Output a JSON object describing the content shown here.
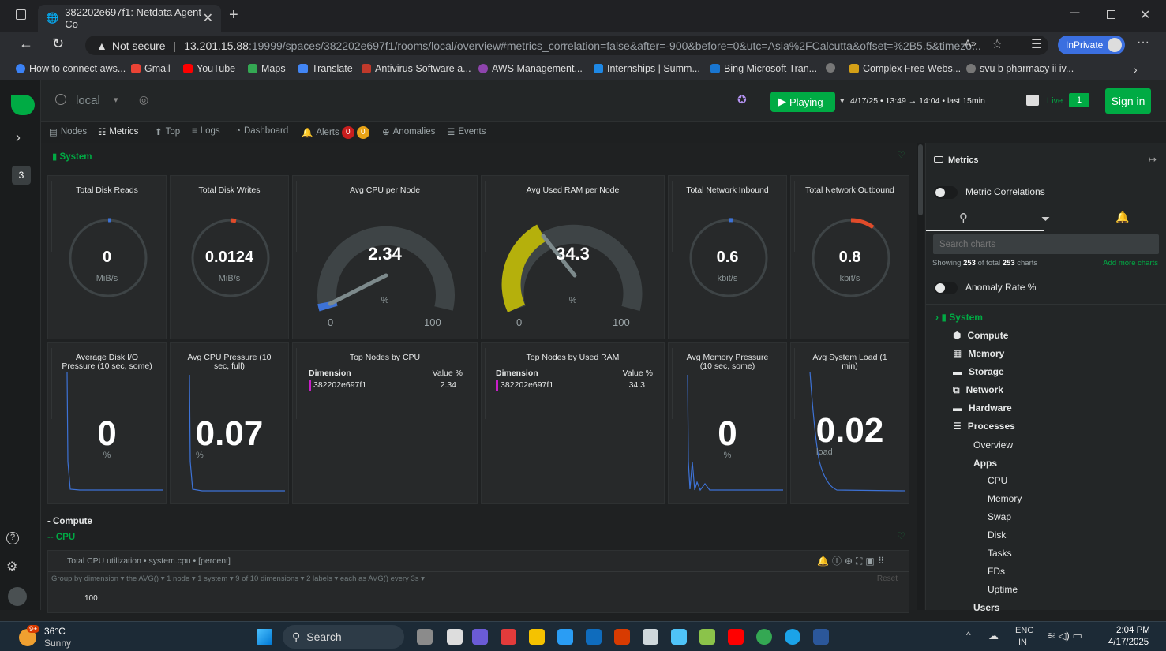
{
  "browser": {
    "tab_title": "382202e697f1: Netdata Agent Co",
    "not_secure": "Not secure",
    "url_host": "13.201.15.88",
    "url_rest": ":19999/spaces/382202e697f1/rooms/local/overview#metrics_correlation=false&after=-900&before=0&utc=Asia%2FCalcutta&offset=%2B5.5&timezo...",
    "inprivate": "InPrivate",
    "bookmarks": [
      "How to connect aws...",
      "Gmail",
      "YouTube",
      "Maps",
      "Translate",
      "Antivirus Software a...",
      "AWS Management...",
      "Internships | Summ...",
      "Bing Microsoft Tran...",
      "Complex Free Webs...",
      "svu b pharmacy ii iv..."
    ]
  },
  "header": {
    "room": "local",
    "playing": "Playing",
    "timerange": "4/17/25 • 13:49 → 14:04 • last 15min",
    "live": "Live",
    "live_count": "1",
    "signin": "Sign in"
  },
  "rail": {
    "badge": "3"
  },
  "nav": {
    "tabs": [
      "Nodes",
      "Metrics",
      "Top",
      "Logs",
      "Dashboard",
      "Alerts",
      "Anomalies",
      "Events"
    ],
    "alert_crit": "0",
    "alert_warn": "0"
  },
  "main": {
    "system_title": "System",
    "gauges": [
      {
        "title": "Total Disk Reads",
        "value": "0",
        "unit": "MiB/s"
      },
      {
        "title": "Total Disk Writes",
        "value": "0.0124",
        "unit": "MiB/s"
      },
      {
        "title": "Avg CPU per Node",
        "value": "2.34",
        "unit": "%",
        "min": "0",
        "max": "100"
      },
      {
        "title": "Avg Used RAM per Node",
        "value": "34.3",
        "unit": "%",
        "min": "0",
        "max": "100"
      },
      {
        "title": "Total Network Inbound",
        "value": "0.6",
        "unit": "kbit/s"
      },
      {
        "title": "Total Network Outbound",
        "value": "0.8",
        "unit": "kbit/s"
      }
    ],
    "numbers": [
      {
        "title": "Average Disk I/O Pressure (10 sec, some)",
        "value": "0",
        "unit": "%"
      },
      {
        "title": "Avg CPU Pressure (10 sec, full)",
        "value": "0.07",
        "unit": "%"
      },
      {
        "title": "Avg Memory Pressure (10 sec, some)",
        "value": "0",
        "unit": "%"
      },
      {
        "title": "Avg System Load (1 min)",
        "value": "0.02",
        "unit": "load"
      }
    ],
    "tables": [
      {
        "title": "Top Nodes by CPU",
        "col1": "Dimension",
        "col2": "Value %",
        "name": "382202e697f1",
        "value": "2.34"
      },
      {
        "title": "Top Nodes by Used RAM",
        "col1": "Dimension",
        "col2": "Value %",
        "name": "382202e697f1",
        "value": "34.3"
      }
    ],
    "compute_title": "- Compute",
    "cpu_title": "-- CPU",
    "chart_title": "Total CPU utilization • system.cpu • [percent]",
    "groupby": "Group by dimension ▾  the AVG() ▾  1 node ▾  1 system ▾  9 of 10 dimensions ▾  2 labels ▾  each as AVG() every 3s ▾",
    "reset": "Reset",
    "y100": "100"
  },
  "panel": {
    "title": "Metrics",
    "corr": "Metric Correlations",
    "search_placeholder": "Search charts",
    "showing_pre": "Showing ",
    "showing_a": "253",
    "showing_mid": " of total ",
    "showing_b": "253",
    "showing_post": " charts",
    "add_more": "Add more charts",
    "anomaly": "Anomaly Rate %",
    "system": "System",
    "groups": [
      "Compute",
      "Memory",
      "Storage",
      "Network",
      "Hardware",
      "Processes"
    ],
    "sub": [
      "Overview",
      "Apps"
    ],
    "apps": [
      "CPU",
      "Memory",
      "Swap",
      "Disk",
      "Tasks",
      "FDs",
      "Uptime"
    ],
    "users": "Users"
  },
  "taskbar": {
    "temp": "36°C",
    "weather": "Sunny",
    "search": "Search",
    "lang1": "ENG",
    "lang2": "IN",
    "time": "2:04 PM",
    "date": "4/17/2025",
    "notif": "9+"
  },
  "colors": {
    "accent": "#00ab44",
    "gauge_track": "#3e4446",
    "ram_fill": "#b5b00c",
    "cpu_fill": "#3d72d6"
  }
}
